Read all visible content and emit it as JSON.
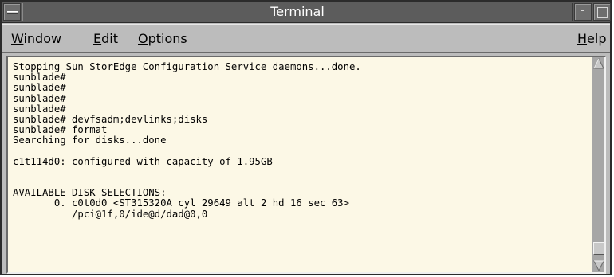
{
  "window": {
    "title": "Terminal"
  },
  "menubar": {
    "window": {
      "label": "Window",
      "mnemonic": "W",
      "rest": "indow"
    },
    "edit": {
      "label": "Edit",
      "mnemonic": "E",
      "rest": "dit"
    },
    "options": {
      "label": "Options",
      "mnemonic": "O",
      "rest": "ptions"
    },
    "help": {
      "label": "Help",
      "mnemonic": "H",
      "rest": "elp"
    }
  },
  "terminal": {
    "lines": [
      "Stopping Sun StorEdge Configuration Service daemons...done.",
      "sunblade#",
      "sunblade#",
      "sunblade#",
      "sunblade#",
      "sunblade# devfsadm;devlinks;disks",
      "sunblade# format",
      "Searching for disks...done",
      "",
      "c1t114d0: configured with capacity of 1.95GB",
      "",
      "",
      "AVAILABLE DISK SELECTIONS:",
      "       0. c0t0d0 <ST315320A cyl 29649 alt 2 hd 16 sec 63>",
      "          /pci@1f,0/ide@d/dad@0,0"
    ]
  },
  "colors": {
    "titlebar": "#5c5c5c",
    "chrome": "#bcbcbc",
    "terminal_bg": "#fcf8e6",
    "terminal_fg": "#000000"
  },
  "icons": {
    "window_menu": "window-menu-icon",
    "minimize": "minimize-icon",
    "maximize": "maximize-icon",
    "scroll_up": "scroll-up-arrow-icon",
    "scroll_down": "scroll-down-arrow-icon"
  }
}
